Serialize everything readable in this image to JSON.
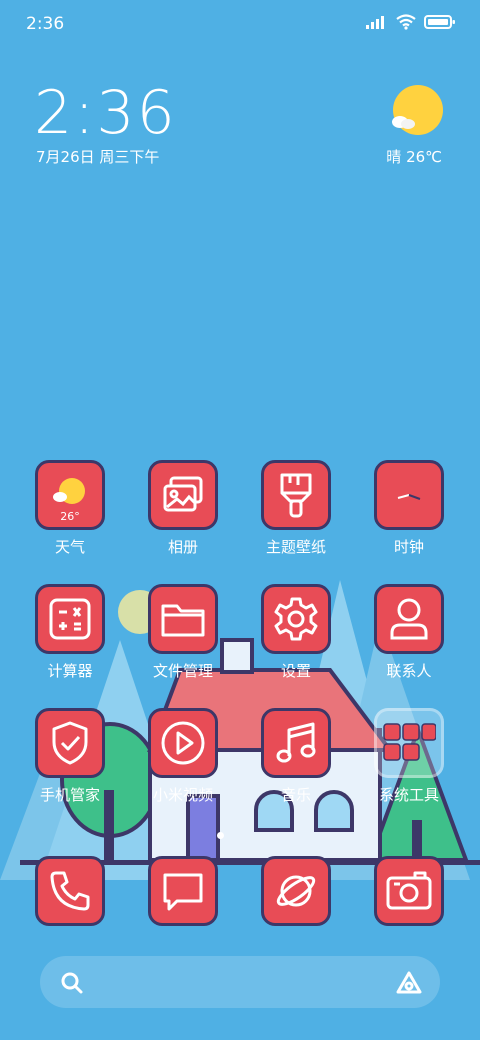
{
  "status": {
    "time": "2:36"
  },
  "clock_widget": {
    "time": "2:36",
    "date": "7月26日 周三下午"
  },
  "weather_widget": {
    "text": "晴 26℃",
    "icon": "sun-cloud-icon"
  },
  "apps": [
    {
      "label": "天气",
      "icon": "weather-icon",
      "badge": "26°"
    },
    {
      "label": "相册",
      "icon": "gallery-icon"
    },
    {
      "label": "主题壁纸",
      "icon": "theme-brush-icon"
    },
    {
      "label": "时钟",
      "icon": "clock-icon"
    },
    {
      "label": "计算器",
      "icon": "calculator-icon"
    },
    {
      "label": "文件管理",
      "icon": "folder-icon"
    },
    {
      "label": "设置",
      "icon": "gear-icon"
    },
    {
      "label": "联系人",
      "icon": "person-icon"
    },
    {
      "label": "手机管家",
      "icon": "shield-icon"
    },
    {
      "label": "小米视频",
      "icon": "play-icon"
    },
    {
      "label": "音乐",
      "icon": "music-note-icon"
    },
    {
      "label": "系统工具",
      "icon": "folder-grid-icon"
    }
  ],
  "dock": [
    {
      "icon": "phone-icon"
    },
    {
      "icon": "message-icon"
    },
    {
      "icon": "browser-planet-icon"
    },
    {
      "icon": "camera-icon"
    }
  ],
  "search": {
    "icon": "search-icon",
    "assistant_icon": "assistant-icon"
  },
  "colors": {
    "background": "#4fb0e4",
    "tile": "#e84c56",
    "tile_border": "#3d3768",
    "sun": "#ffd23f"
  }
}
